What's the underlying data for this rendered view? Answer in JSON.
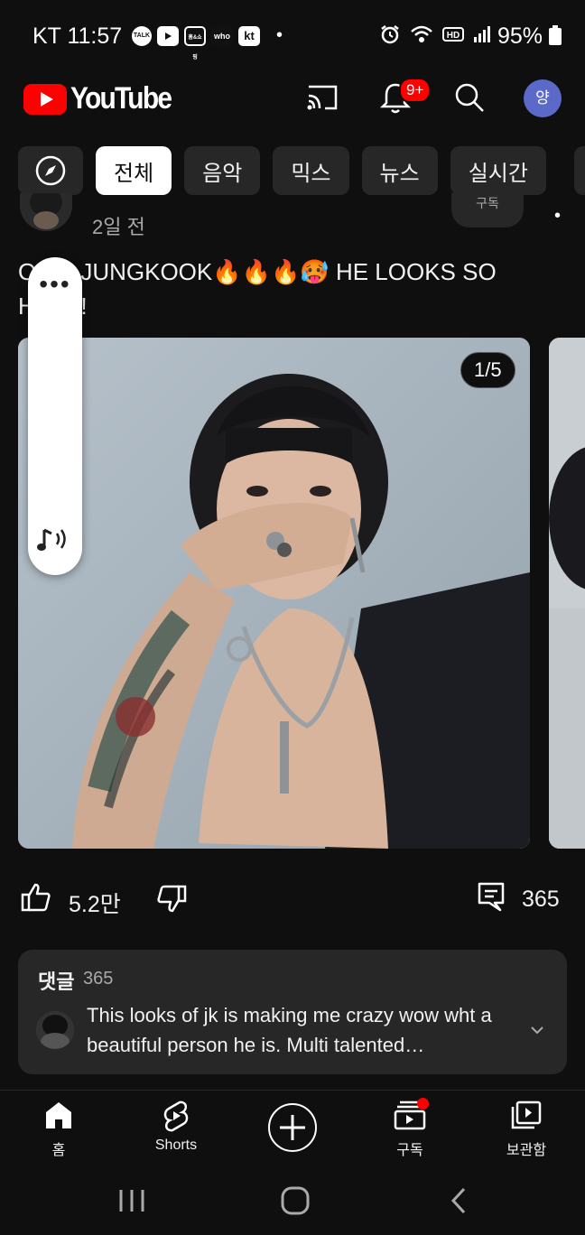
{
  "status_bar": {
    "carrier_time": "KT 11:57",
    "battery": "95%",
    "notification_icons": [
      "TALK",
      "YT",
      "홈&쇼핑",
      "who",
      "kt"
    ]
  },
  "header": {
    "logo_text": "YouTube",
    "notification_badge": "9+",
    "account_initial": "양"
  },
  "chips": [
    "전체",
    "음악",
    "믹스",
    "뉴스",
    "실시간"
  ],
  "post": {
    "time": "2일 전",
    "subscribe_label": "구독",
    "text_line1": "OMG JUNGKOOK🔥🔥🔥🥵 HE LOOKS SO",
    "text_line2": "HOT!!!",
    "image_counter": "1/5",
    "likes": "5.2만",
    "comments": "365"
  },
  "comments_card": {
    "title": "댓글",
    "count": "365",
    "top_comment": "This looks of jk is making me crazy wow wht a beautiful person he is. Multi talented…"
  },
  "bottom_nav": {
    "home": "홈",
    "shorts": "Shorts",
    "subscriptions": "구독",
    "library": "보관함"
  },
  "colors": {
    "background": "#0f0f0f",
    "surface": "#272727",
    "brand_red": "#ff0000",
    "avatar_bg": "#5b6ac9"
  }
}
